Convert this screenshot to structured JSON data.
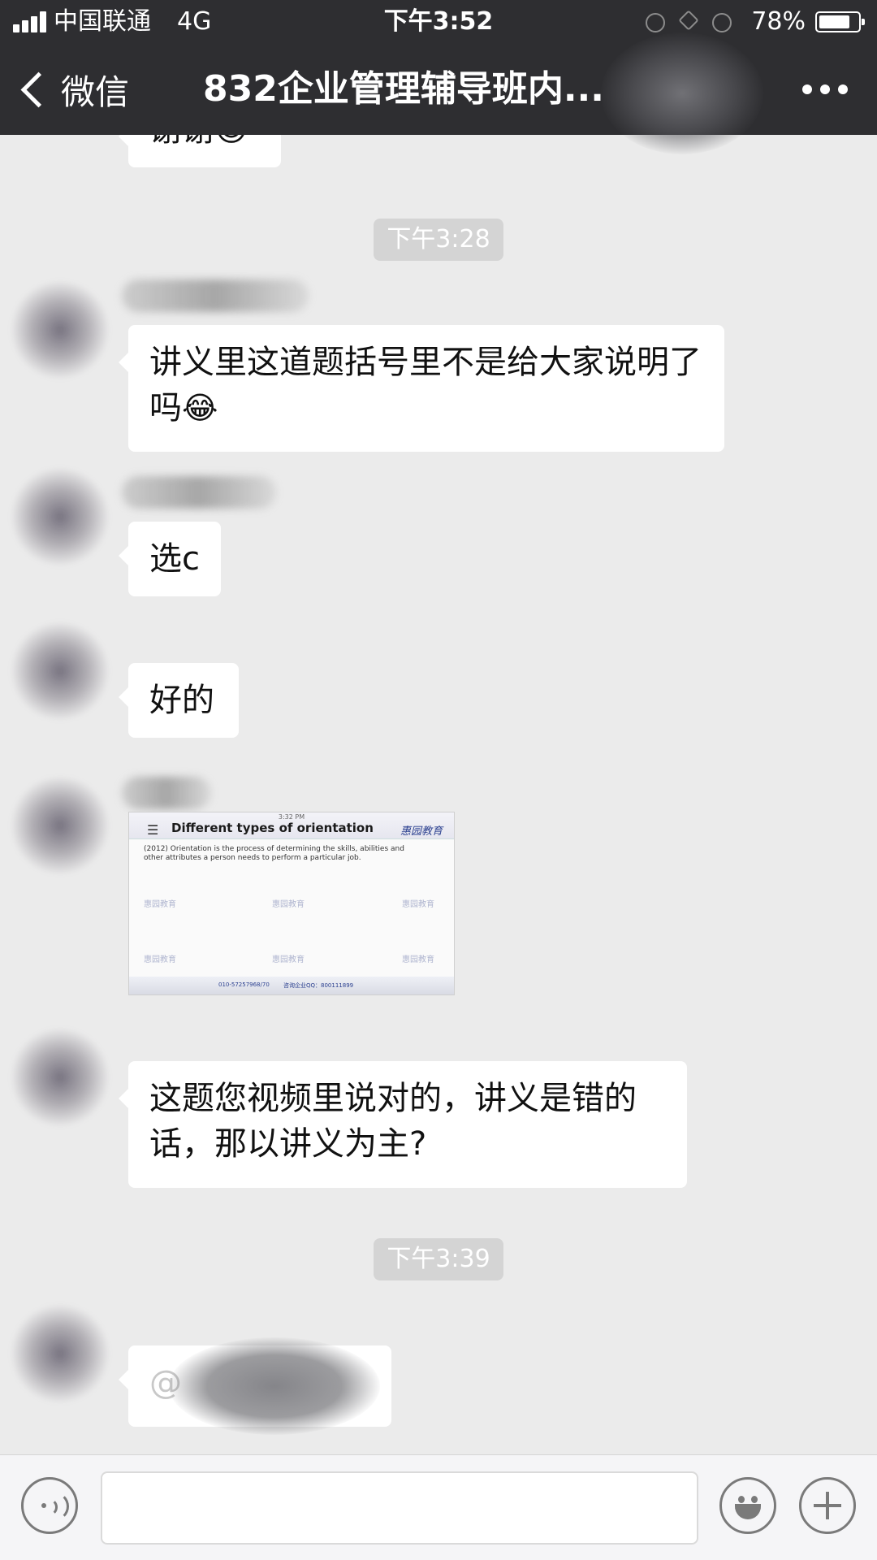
{
  "status_bar": {
    "carrier": "中国联通",
    "network": "4G",
    "time": "下午3:52",
    "battery_percent": "78%"
  },
  "nav": {
    "back_label": "微信",
    "title": "832企业管理辅导班内..."
  },
  "messages": [
    {
      "type": "text",
      "text": "谢谢😊",
      "partial": true
    },
    {
      "type": "timestamp",
      "text": "下午3:28"
    },
    {
      "type": "text",
      "text": "讲义里这道题括号里不是给大家说明了吗",
      "emoji": "😂"
    },
    {
      "type": "text",
      "text": "选c"
    },
    {
      "type": "text",
      "text": "好的"
    },
    {
      "type": "image",
      "image": {
        "time": "3:32 PM",
        "title": "Different types of orientation",
        "logo": "惠园教育",
        "body": "(2012) Orientation is the process of determining the skills, abilities and other attributes a person needs to perform a particular job.",
        "watermark": "惠园教育",
        "footer_phone": "010-57257968/70",
        "footer_qq": "咨询企业QQ：800111899"
      }
    },
    {
      "type": "text",
      "text": "这题您视频里说对的，讲义是错的话，那以讲义为主?"
    },
    {
      "type": "timestamp",
      "text": "下午3:39"
    },
    {
      "type": "text",
      "text": "@",
      "redacted": true
    }
  ],
  "icons": {
    "back": "chevron-left-icon",
    "more": "more-dots-icon",
    "voice": "voice-icon",
    "emoji": "smiley-icon",
    "plus": "plus-icon"
  }
}
